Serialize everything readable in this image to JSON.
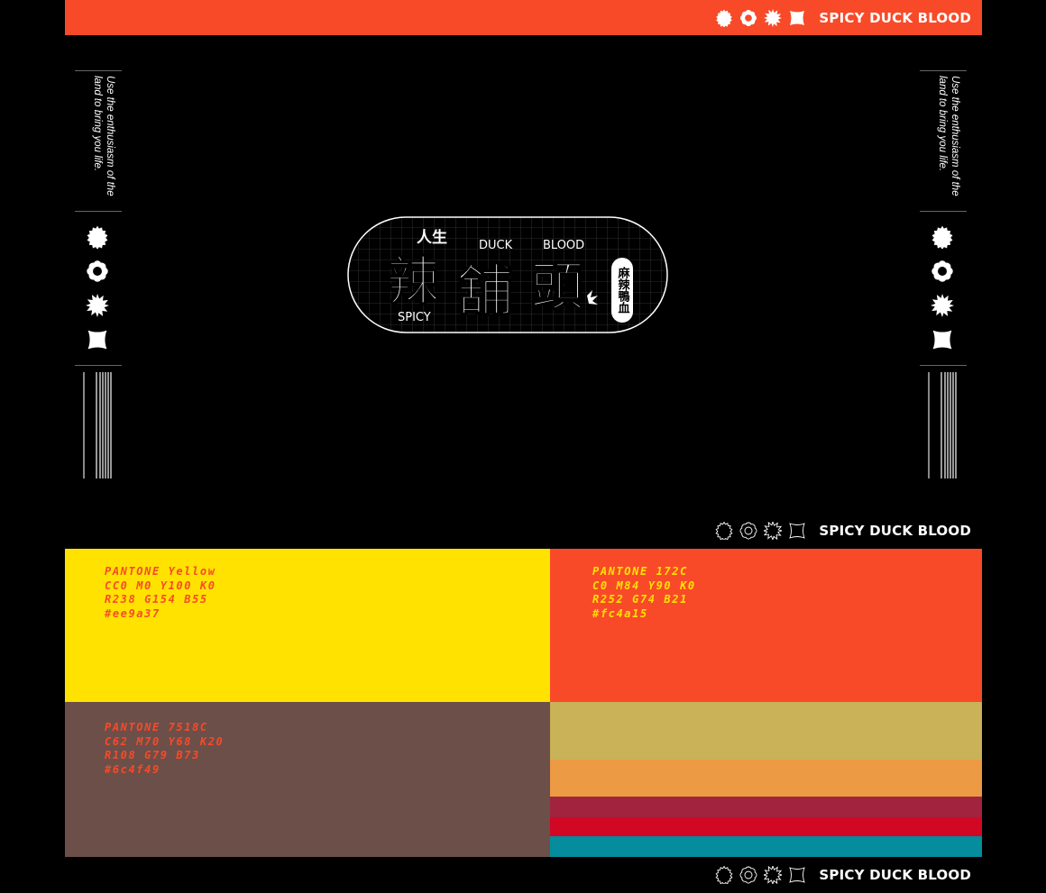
{
  "brand_text": "SPICY DUCK BLOOD",
  "tagline": "Use the enthusiasm of the land to bring you life.",
  "logo": {
    "line_top": "人生",
    "word_duck": "DUCK",
    "word_blood": "BLOOD",
    "char_1": "辣",
    "char_2": "舖",
    "char_3": "頭",
    "word_spicy": "SPICY",
    "badge": "麻辣鴨血"
  },
  "icons": [
    "sun-icon",
    "flower-icon",
    "burst-icon",
    "square-icon"
  ],
  "swatches": [
    {
      "name": "PANTONE Yellow",
      "cmyk": "CC0 M0 Y100 K0",
      "rgb": "R238 G154 B55",
      "hex": "#ee9a37",
      "fill": "#ffe200",
      "label_color": "#f84a28"
    },
    {
      "name": "PANTONE 172C",
      "cmyk": "C0 M84 Y90 K0",
      "rgb": "R252 G74 B21",
      "hex": "#fc4a15",
      "fill": "#f84a28",
      "label_color": "#ffe200"
    },
    {
      "name": "PANTONE 7518C",
      "cmyk": "C62 M70 Y68 K20",
      "rgb": "R108 G79 B73",
      "hex": "#6c4f49",
      "fill": "#6c4f49",
      "label_color": "#f84a28"
    }
  ],
  "stripes": [
    "#c9b257",
    "#ec9a44",
    "#a1233e",
    "#d10724",
    "#058c9d"
  ],
  "colors": {
    "accent_orange": "#f84a28",
    "accent_yellow": "#ffe200",
    "background": "#000000"
  }
}
